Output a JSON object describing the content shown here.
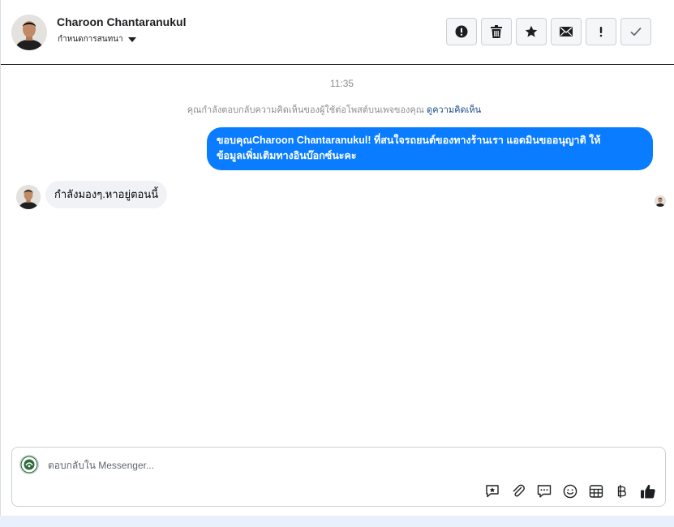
{
  "header": {
    "name": "Charoon Chantaranukul",
    "stage_label": "กำหนดการสนทนา",
    "actions": [
      {
        "id": "spam",
        "icon": "alert-circle-icon"
      },
      {
        "id": "delete",
        "icon": "trash-icon"
      },
      {
        "id": "star",
        "icon": "star-icon"
      },
      {
        "id": "unread",
        "icon": "envelope-icon"
      },
      {
        "id": "followup",
        "icon": "exclamation-icon"
      },
      {
        "id": "done",
        "icon": "checkmark-icon"
      }
    ]
  },
  "thread": {
    "timestamp": "11:35",
    "notice_text": "คุณกำลังตอบกลับความคิดเห็นของผู้ใช้ต่อโพสต์บนเพจของคุณ",
    "notice_link": "ดูความคิดเห็น",
    "outgoing": {
      "line1": "ขอบคุณCharoon Chantaranukul! ที่สนใจรถยนต์ของทางร้านเรา แอดมินขออนุญาติ ให้",
      "line2": "ข้อมูลเพิ่มเติมทางอินบ๊อกซ์นะคะ"
    },
    "incoming": {
      "text": "กำลังมองๆ.หาอยู่ตอนนี้"
    }
  },
  "composer": {
    "placeholder": "ตอบกลับใน Messenger...",
    "tools": [
      "saved-reply-icon",
      "attachment-icon",
      "chat-bubble-icon",
      "emoji-icon",
      "table-icon",
      "baht-icon",
      "thumbs-up-icon"
    ]
  },
  "colors": {
    "accent": "#0a7cff",
    "incoming_bubble": "#f0f2f5",
    "muted_text": "#8a8d91",
    "link": "#1c4a8a"
  }
}
